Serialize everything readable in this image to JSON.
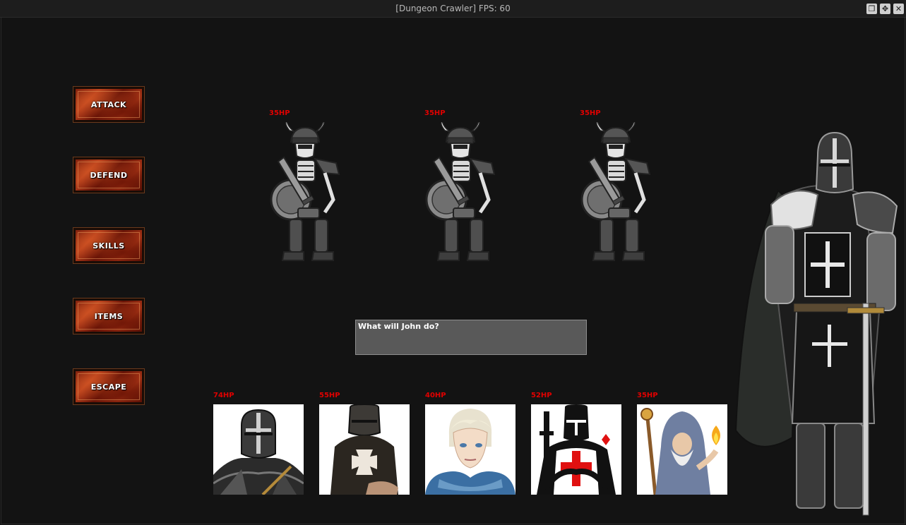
{
  "window": {
    "title": "[Dungeon Crawler] FPS: 60"
  },
  "commands": [
    {
      "label": "ATTACK"
    },
    {
      "label": "DEFEND"
    },
    {
      "label": "SKILLS"
    },
    {
      "label": "ITEMS"
    },
    {
      "label": "ESCAPE"
    }
  ],
  "enemies": [
    {
      "hp": "35HP",
      "sprite": "skeleton-warrior"
    },
    {
      "hp": "35HP",
      "sprite": "skeleton-warrior"
    },
    {
      "hp": "35HP",
      "sprite": "skeleton-warrior"
    }
  ],
  "dialog": {
    "text": "What will John do?"
  },
  "party": [
    {
      "hp": "74HP",
      "portrait": "crusader-knight"
    },
    {
      "hp": "55HP",
      "portrait": "hospitaller-knight"
    },
    {
      "hp": "40HP",
      "portrait": "blond-youth"
    },
    {
      "hp": "52HP",
      "portrait": "templar-knight"
    },
    {
      "hp": "35HP",
      "portrait": "wizard"
    }
  ],
  "colors": {
    "hp": "#e00000",
    "background": "#131313",
    "dialog_bg": "#595959"
  }
}
